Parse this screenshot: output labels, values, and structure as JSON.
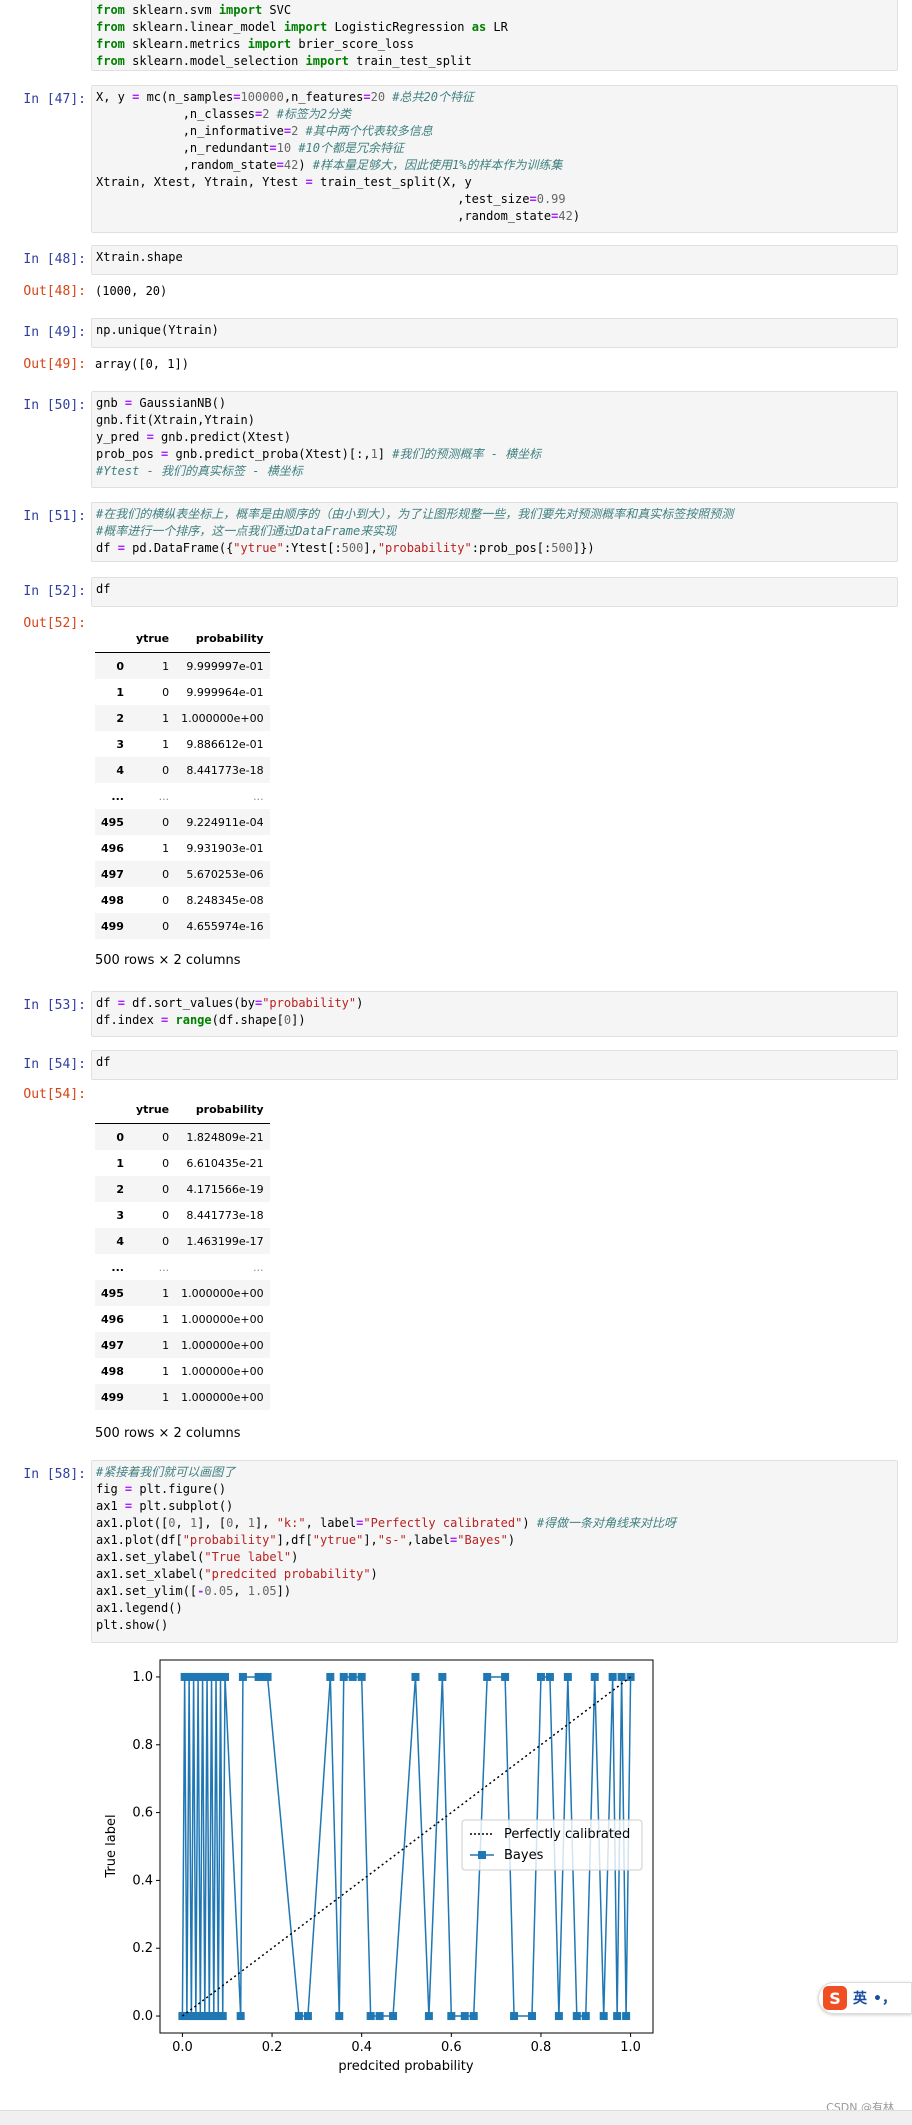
{
  "cells": {
    "imports": {
      "lines": [
        [
          "from",
          "sklearn.svm",
          "import",
          "SVC"
        ],
        [
          "from",
          "sklearn.linear_model",
          "import",
          "LogisticRegression as LR"
        ],
        [
          "from",
          "sklearn.metrics",
          "import",
          "brier_score_loss"
        ],
        [
          "from",
          "sklearn.model_selection",
          "import",
          "train_test_split"
        ]
      ]
    },
    "c47": {
      "prompt": "In [47]:"
    },
    "c48": {
      "prompt": "In [48]:",
      "code": "Xtrain.shape",
      "out_prompt": "Out[48]:",
      "out": "(1000, 20)"
    },
    "c49": {
      "prompt": "In [49]:",
      "code": "np.unique(Ytrain)",
      "out_prompt": "Out[49]:",
      "out": "array([0, 1])"
    },
    "c50": {
      "prompt": "In [50]:"
    },
    "c51": {
      "prompt": "In [51]:"
    },
    "c52": {
      "prompt": "In [52]:",
      "code": "df",
      "out_prompt": "Out[52]:",
      "shape": "500 rows × 2 columns"
    },
    "c53": {
      "prompt": "In [53]:"
    },
    "c54": {
      "prompt": "In [54]:",
      "code": "df",
      "out_prompt": "Out[54]:",
      "shape": "500 rows × 2 columns"
    },
    "c58": {
      "prompt": "In [58]:"
    }
  },
  "table_headers": [
    "",
    "ytrue",
    "probability"
  ],
  "table52": [
    [
      "0",
      "1",
      "9.999997e-01"
    ],
    [
      "1",
      "0",
      "9.999964e-01"
    ],
    [
      "2",
      "1",
      "1.000000e+00"
    ],
    [
      "3",
      "1",
      "9.886612e-01"
    ],
    [
      "4",
      "0",
      "8.441773e-18"
    ],
    [
      "...",
      "...",
      "..."
    ],
    [
      "495",
      "0",
      "9.224911e-04"
    ],
    [
      "496",
      "1",
      "9.931903e-01"
    ],
    [
      "497",
      "0",
      "5.670253e-06"
    ],
    [
      "498",
      "0",
      "8.248345e-08"
    ],
    [
      "499",
      "0",
      "4.655974e-16"
    ]
  ],
  "table54": [
    [
      "0",
      "0",
      "1.824809e-21"
    ],
    [
      "1",
      "0",
      "6.610435e-21"
    ],
    [
      "2",
      "0",
      "4.171566e-19"
    ],
    [
      "3",
      "0",
      "8.441773e-18"
    ],
    [
      "4",
      "0",
      "1.463199e-17"
    ],
    [
      "...",
      "...",
      "..."
    ],
    [
      "495",
      "1",
      "1.000000e+00"
    ],
    [
      "496",
      "1",
      "1.000000e+00"
    ],
    [
      "497",
      "1",
      "1.000000e+00"
    ],
    [
      "498",
      "1",
      "1.000000e+00"
    ],
    [
      "499",
      "1",
      "1.000000e+00"
    ]
  ],
  "chart_data": {
    "type": "line",
    "xlabel": "predcited probability",
    "ylabel": "True label",
    "xlim": [
      -0.05,
      1.05
    ],
    "ylim": [
      -0.05,
      1.05
    ],
    "xticks": [
      "0.0",
      "0.2",
      "0.4",
      "0.6",
      "0.8",
      "1.0"
    ],
    "yticks": [
      "0.0",
      "0.2",
      "0.4",
      "0.6",
      "0.8",
      "1.0"
    ],
    "grid": false,
    "legend_position": "center-right",
    "series": [
      {
        "name": "Perfectly calibrated",
        "style": "dotted",
        "color": "#000000",
        "x": [
          0,
          1
        ],
        "y": [
          0,
          1
        ]
      },
      {
        "name": "Bayes",
        "style": "line-square",
        "color": "#1f77b4",
        "x": [
          0.0,
          0.005,
          0.01,
          0.015,
          0.02,
          0.025,
          0.03,
          0.035,
          0.04,
          0.045,
          0.05,
          0.055,
          0.06,
          0.065,
          0.07,
          0.075,
          0.08,
          0.085,
          0.09,
          0.095,
          0.13,
          0.135,
          0.17,
          0.18,
          0.19,
          0.26,
          0.28,
          0.33,
          0.35,
          0.36,
          0.38,
          0.4,
          0.42,
          0.44,
          0.47,
          0.52,
          0.55,
          0.58,
          0.6,
          0.63,
          0.65,
          0.68,
          0.72,
          0.74,
          0.78,
          0.8,
          0.82,
          0.84,
          0.86,
          0.88,
          0.9,
          0.92,
          0.94,
          0.96,
          0.97,
          0.98,
          0.99,
          1.0
        ],
        "y": [
          0,
          1,
          0,
          1,
          0,
          1,
          0,
          1,
          0,
          1,
          0,
          1,
          0,
          1,
          0,
          1,
          0,
          1,
          0,
          1,
          0,
          1,
          1,
          1,
          1,
          0,
          0,
          1,
          0,
          1,
          1,
          1,
          0,
          0,
          0,
          1,
          0,
          1,
          0,
          0,
          0,
          1,
          1,
          0,
          0,
          1,
          1,
          0,
          1,
          0,
          0,
          1,
          0,
          1,
          0,
          1,
          0,
          1
        ]
      }
    ]
  },
  "watermark": "CSDN @有林",
  "ime": {
    "label": "英",
    "extra": "•，"
  }
}
